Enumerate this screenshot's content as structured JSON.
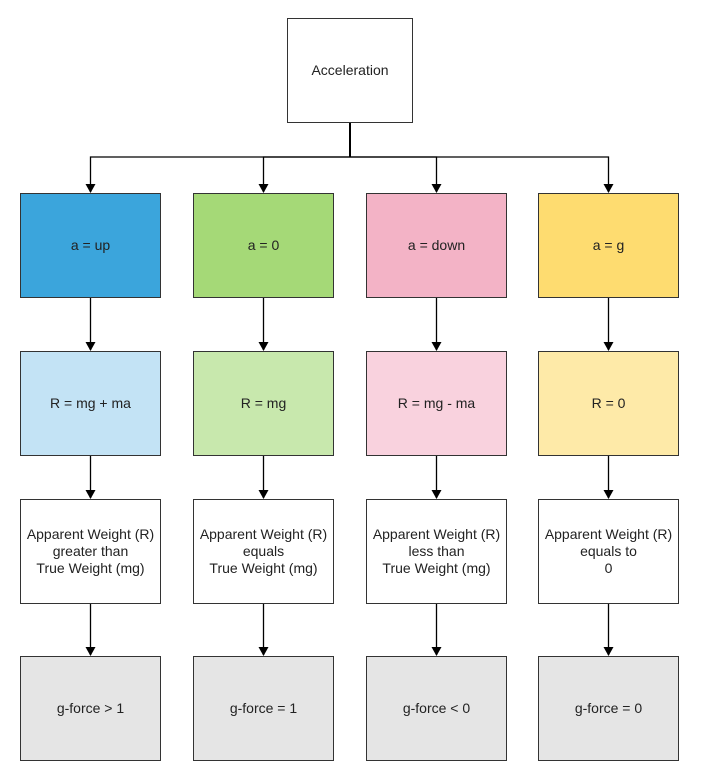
{
  "root": {
    "label": "Acceleration",
    "color": "#ffffff"
  },
  "columns": [
    {
      "accel": "a = up",
      "reaction": "R = mg + ma",
      "weight": "Apparent Weight (R)\ngreater than\nTrue Weight (mg)",
      "gforce": "g-force > 1",
      "color_dark": "#3ba5dc",
      "color_light": "#c3e3f5"
    },
    {
      "accel": "a = 0",
      "reaction": "R = mg",
      "weight": "Apparent Weight (R)\nequals\nTrue Weight (mg)",
      "gforce": "g-force = 1",
      "color_dark": "#a5d977",
      "color_light": "#c8e8ad"
    },
    {
      "accel": "a = down",
      "reaction": "R = mg - ma",
      "weight": "Apparent Weight (R)\nless than\nTrue Weight (mg)",
      "gforce": "g-force < 0",
      "color_dark": "#f3b3c6",
      "color_light": "#f9d2de"
    },
    {
      "accel": "a = g",
      "reaction": "R = 0",
      "weight": "Apparent Weight (R)\nequals to\n0",
      "gforce": "g-force = 0",
      "color_dark": "#fedc70",
      "color_light": "#feeaa8"
    }
  ],
  "colors": {
    "weight_box": "#ffffff",
    "gforce_box": "#e5e5e5",
    "line": "#000000"
  }
}
